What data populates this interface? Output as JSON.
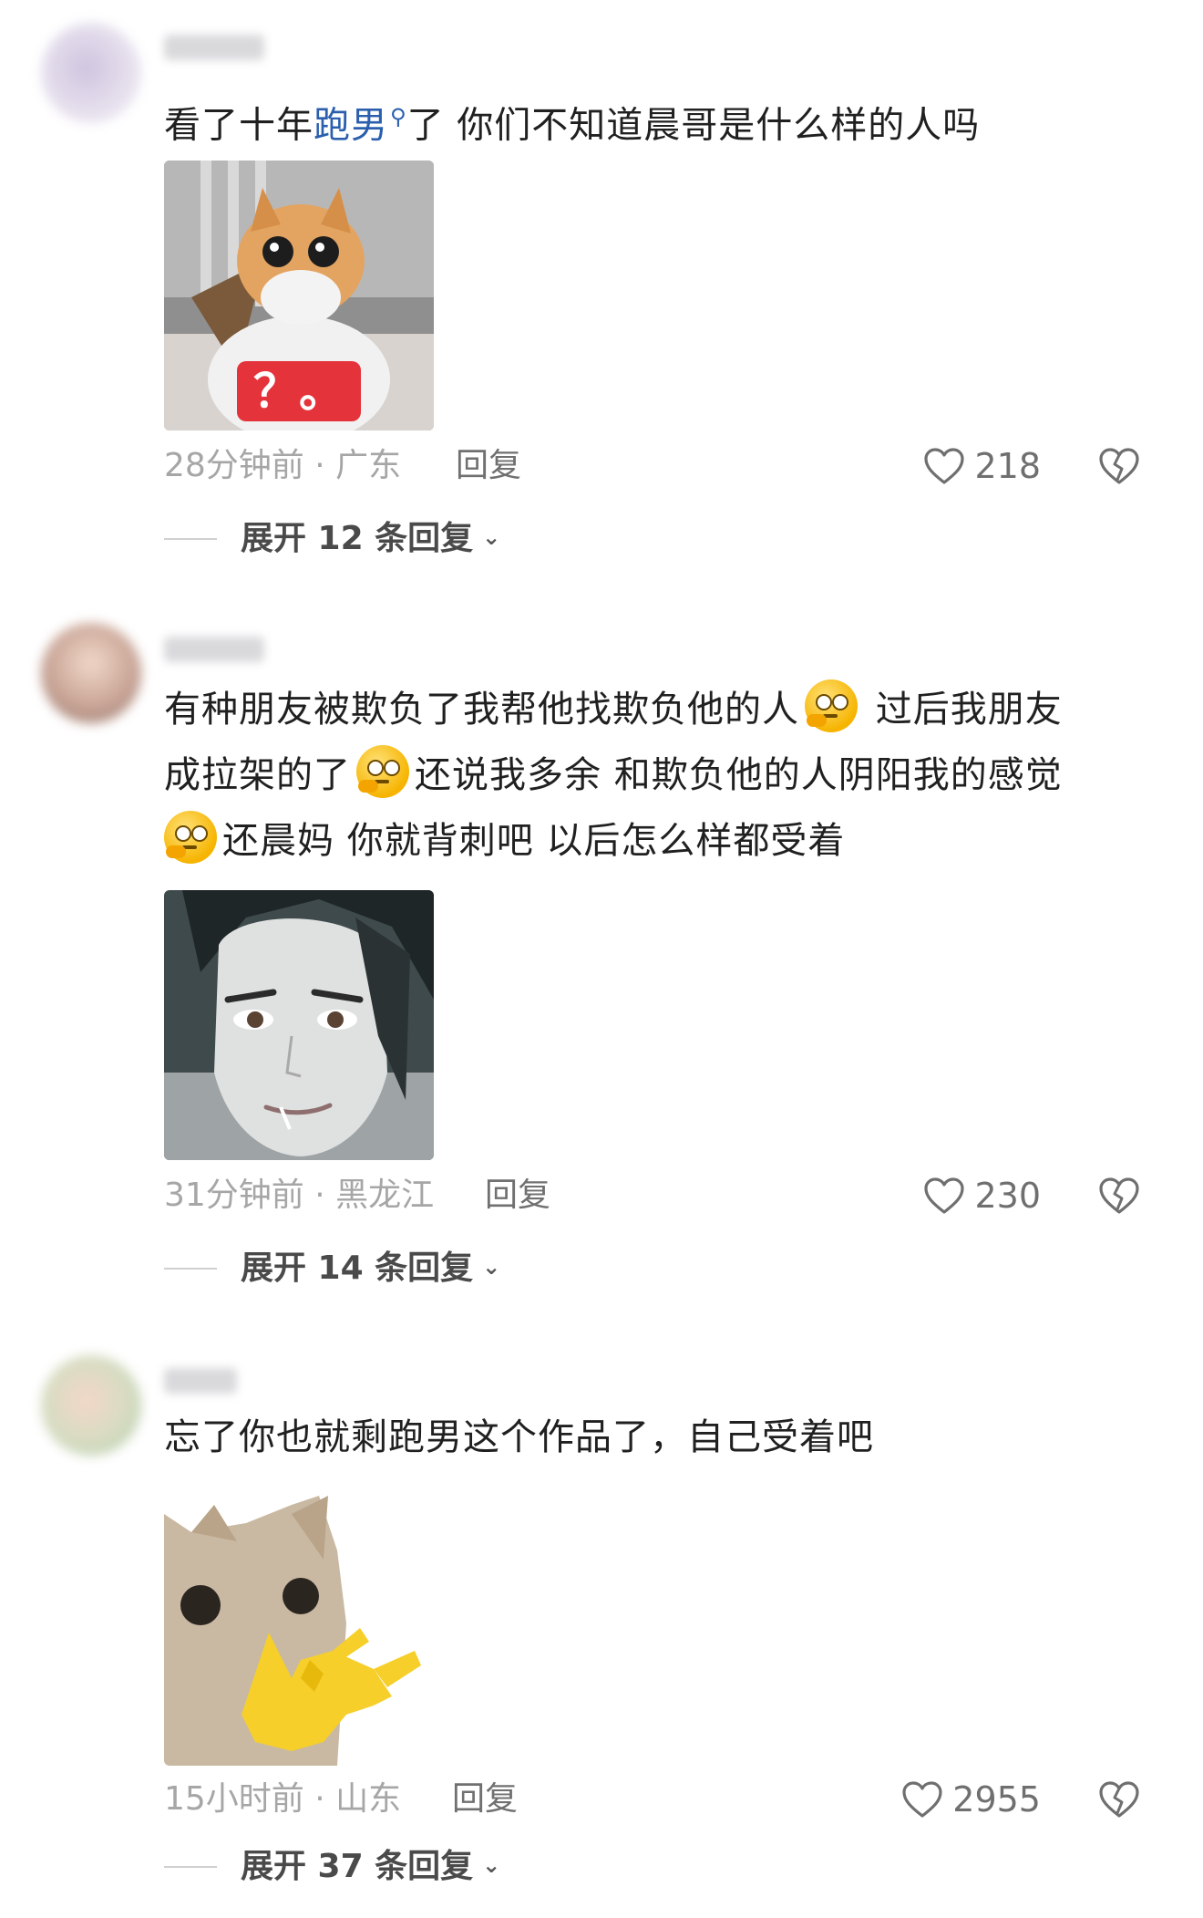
{
  "comments": [
    {
      "text_before": "看了十年",
      "topic": "跑男",
      "text_after": "了 你们不知道晨哥是什么样的人吗",
      "image_caption": "？。",
      "meta": "28分钟前 · 广东",
      "reply": "回复",
      "likes": "218",
      "expand": "展开 12 条回复"
    },
    {
      "line1a": "有种朋友被欺负了我帮他找欺负他的人",
      "line1b": " 过后我朋友",
      "line2a": "成拉架的了",
      "line2b": "还说我多余 和欺负他的人阴阳我的感觉",
      "line3b": "还晨妈 你就背刺吧 以后怎么样都受着",
      "meta": "31分钟前 · 黑龙江",
      "reply": "回复",
      "likes": "230",
      "expand": "展开 14 条回复"
    },
    {
      "text": "忘了你也就剩跑男这个作品了，自己受着吧",
      "meta": "15小时前 · 山东",
      "reply": "回复",
      "likes": "2955",
      "expand": "展开 37 条回复"
    }
  ],
  "icons": {
    "like": "heart-outline-icon",
    "dislike": "broken-heart-icon",
    "expand": "chevron-down-icon",
    "search": "search-icon",
    "emoji": "thinking-face-emoji"
  },
  "colors": {
    "topic_link": "#2b5fae",
    "meta": "#a6a6a6",
    "body_text": "#202020"
  }
}
